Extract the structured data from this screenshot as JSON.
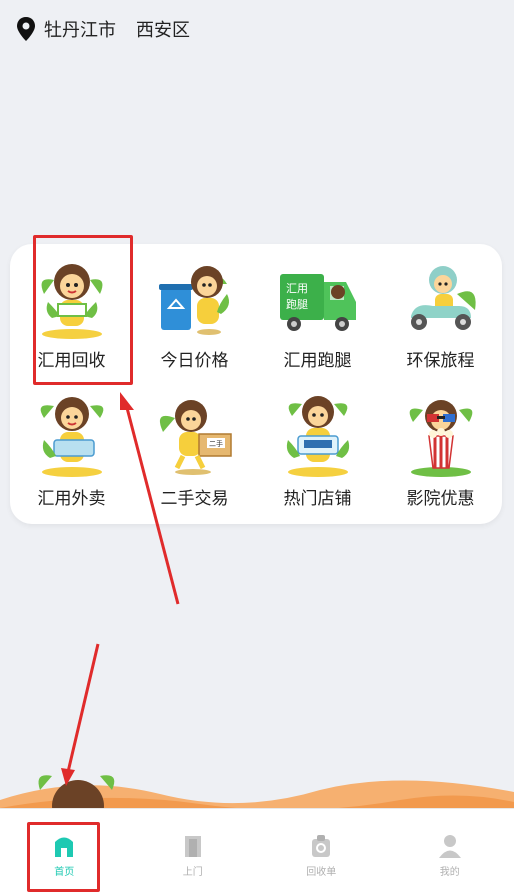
{
  "location": {
    "city": "牡丹江市",
    "district": "西安区"
  },
  "services": [
    {
      "label": "汇用回收",
      "icon": "recycle-mascot-icon"
    },
    {
      "label": "今日价格",
      "icon": "trash-bin-mascot-icon"
    },
    {
      "label": "汇用跑腿",
      "icon": "delivery-truck-mascot-icon"
    },
    {
      "label": "环保旅程",
      "icon": "scooter-mascot-icon"
    },
    {
      "label": "汇用外卖",
      "icon": "food-box-mascot-icon"
    },
    {
      "label": "二手交易",
      "icon": "parcel-mascot-icon"
    },
    {
      "label": "热门店铺",
      "icon": "shop-mascot-icon"
    },
    {
      "label": "影院优惠",
      "icon": "3d-glasses-popcorn-mascot-icon"
    }
  ],
  "tabs": [
    {
      "label": "首页",
      "icon": "home-icon",
      "active": true
    },
    {
      "label": "上门",
      "icon": "door-icon",
      "active": false
    },
    {
      "label": "回收单",
      "icon": "recycle-order-icon",
      "active": false
    },
    {
      "label": "我的",
      "icon": "profile-icon",
      "active": false
    }
  ],
  "colors": {
    "accent": "#1ec9b2",
    "highlight": "#e02b2b",
    "wave": "#f4a050"
  }
}
